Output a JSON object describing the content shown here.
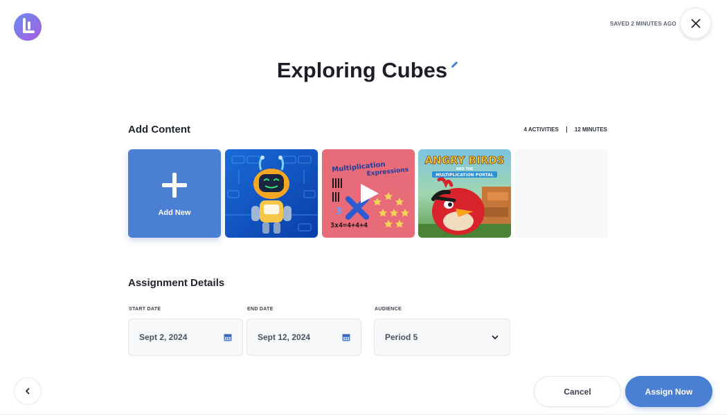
{
  "header": {
    "saved_status": "SAVED 2 MINUTES AGO",
    "close_icon": "close-icon",
    "logo_icon": "logo-icon"
  },
  "assignment": {
    "title": "Exploring Cubes",
    "edit_icon": "pencil-icon"
  },
  "content": {
    "section_title": "Add Content",
    "activities_count": "4 ACTIVITIES",
    "duration": "12 MINUTES",
    "add_new_label": "Add New",
    "cards": [
      {
        "type": "robot-game",
        "icon": "robot-game-thumbnail"
      },
      {
        "type": "video",
        "title_line1": "Multiplication",
        "title_line2": "Expressions",
        "equation": "3x4=4+4+4",
        "icon": "play-icon"
      },
      {
        "type": "game",
        "title": "ANGRY BIRDS",
        "subtitle_top": "AND THE",
        "subtitle": "MULTIPLICATION PORTAL",
        "icon": "angry-bird-thumbnail"
      }
    ]
  },
  "details": {
    "section_title": "Assignment Details",
    "start_date": {
      "label": "START DATE",
      "value": "Sept 2, 2024",
      "icon": "calendar-icon"
    },
    "end_date": {
      "label": "END DATE",
      "value": "Sept 12, 2024",
      "icon": "calendar-icon"
    },
    "audience": {
      "label": "AUDIENCE",
      "value": "Period 5",
      "icon": "chevron-down-icon"
    }
  },
  "footer": {
    "back_icon": "chevron-left-icon",
    "cancel_label": "Cancel",
    "assign_label": "Assign Now"
  },
  "colors": {
    "primary": "#4a7fd4",
    "field_bg": "#f6f8fa",
    "text_dark": "#1c1f27",
    "video_card_bg": "#e76b78"
  }
}
